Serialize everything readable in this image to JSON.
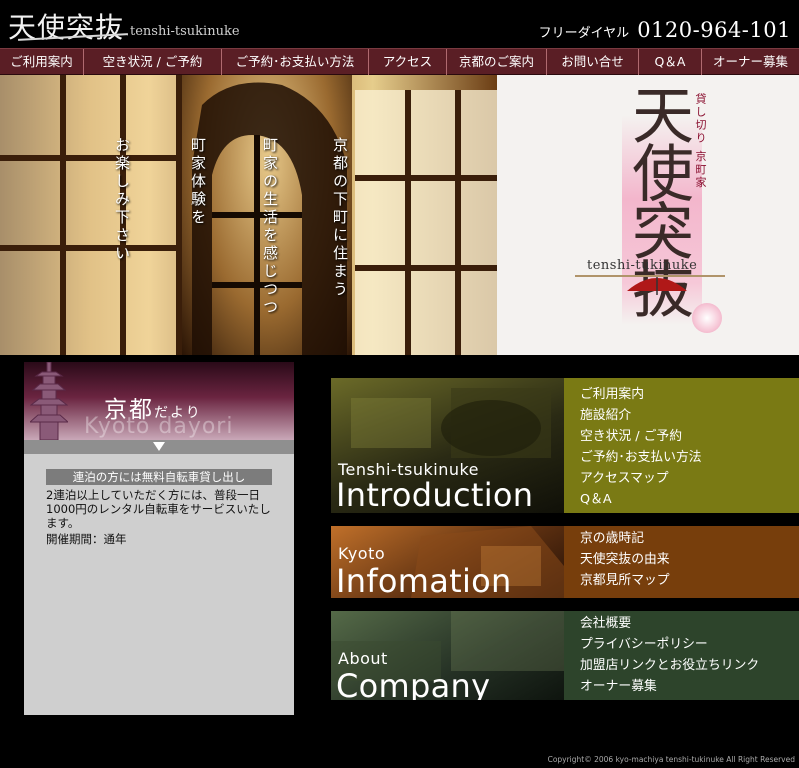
{
  "header": {
    "logo_kanji": "天使突抜",
    "logo_roman": "tenshi-tsukinuke",
    "freedial_label": "フリーダイヤル",
    "freedial_number": "0120-964-101"
  },
  "nav": {
    "items": [
      {
        "label": "ご利用案内"
      },
      {
        "label": "空き状況 / ご予約"
      },
      {
        "label": "ご予約･お支払い方法"
      },
      {
        "label": "アクセス"
      },
      {
        "label": "京都のご案内"
      },
      {
        "label": "お問い合せ"
      },
      {
        "label": "Q＆A"
      },
      {
        "label": "オーナー募集"
      }
    ]
  },
  "hero": {
    "vertical_texts": [
      "京都の下町に住まう",
      "町家の生活を感じつつ",
      "町家体験を",
      "お楽しみ下さい"
    ],
    "logo_big": "天使突抜",
    "logo_sub": "貸し切り 京町家",
    "logo_roman": "tenshi-tukinuke"
  },
  "dayori": {
    "title": "京都",
    "title_small": "だより",
    "ghost": "Kyoto dayori",
    "notice_title": "連泊の方には無料自転車貸し出し",
    "notice_body": "2連泊以上していただく方には、普段一日1000円のレンタル自転車をサービスいたします。",
    "notice_period": "開催期間：通年"
  },
  "sections": {
    "intro": {
      "sub": "Tenshi-tsukinuke",
      "main": "Introduction",
      "links": [
        "ご利用案内",
        "施設紹介",
        "空き状況 / ご予約",
        "ご予約･お支払い方法",
        "アクセスマップ",
        "Q＆A"
      ]
    },
    "kyoto": {
      "sub": "Kyoto",
      "main": "Infomation",
      "links": [
        "京の歳時記",
        "天使突抜の由来",
        "京都見所マップ"
      ]
    },
    "company": {
      "sub": "About",
      "main": "Company",
      "links": [
        "会社概要",
        "プライバシーポリシー",
        "加盟店リンクとお役立ちリンク",
        "オーナー募集"
      ]
    }
  },
  "footer": {
    "copyright": "Copyright© 2006 kyo-machiya tenshi-tukinuke All Right Reserved"
  },
  "colors": {
    "nav_bg": "#5a1e25",
    "intro_bg": "#7a7a14",
    "kyoto_bg": "#773e0c",
    "company_bg": "#2d442b"
  }
}
